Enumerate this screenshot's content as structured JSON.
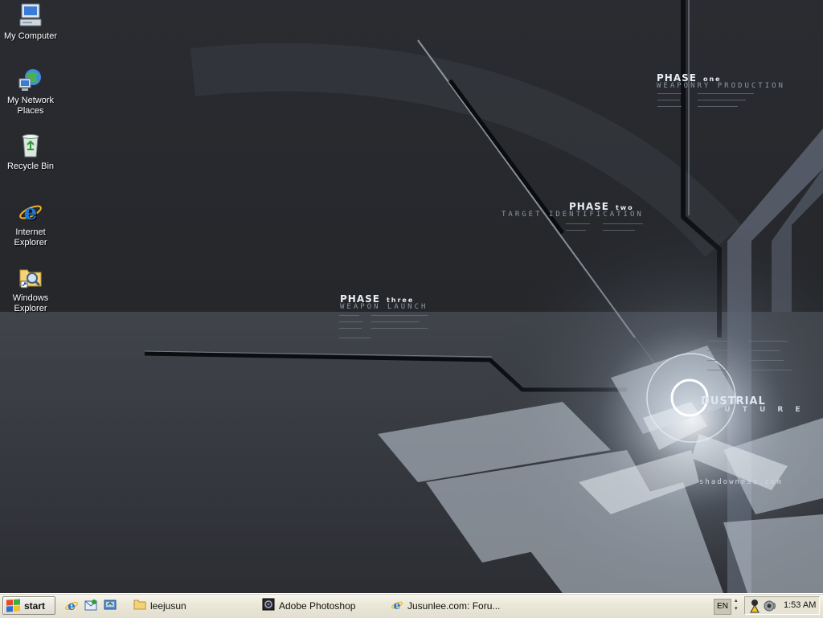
{
  "desktop": {
    "icons": [
      {
        "label": "My Computer",
        "icon": "my-computer-icon"
      },
      {
        "label": "My Network Places",
        "icon": "network-places-icon"
      },
      {
        "label": "Recycle Bin",
        "icon": "recycle-bin-icon"
      },
      {
        "label": "Internet Explorer",
        "icon": "internet-explorer-icon"
      },
      {
        "label": "Windows Explorer",
        "icon": "windows-explorer-icon"
      }
    ]
  },
  "wallpaper": {
    "phase_one": {
      "title": "PHASE",
      "number": "one",
      "subtitle": "WEAPONRY PRODUCTION"
    },
    "phase_two": {
      "title": "PHASE",
      "number": "two",
      "subtitle": "TARGET IDENTIFICATION"
    },
    "phase_three": {
      "title": "PHASE",
      "number": "three",
      "subtitle": "WEAPON LAUNCH"
    },
    "brand": "DUSTRIAL",
    "brand_sub": "F U T U R E",
    "site": "shadowness.com"
  },
  "taskbar": {
    "start_label": "start",
    "quick_launch": [
      "internet-explorer-icon",
      "outlook-express-icon",
      "show-desktop-icon"
    ],
    "buttons": [
      {
        "label": "leejusun",
        "icon": "folder-icon"
      },
      {
        "label": "Adobe Photoshop",
        "icon": "photoshop-icon"
      },
      {
        "label": "Jusunlee.com: Foru...",
        "icon": "internet-explorer-icon"
      }
    ],
    "language": "EN",
    "clock": "1:53 AM"
  },
  "colors": {
    "taskbar_bg": "#ece9d8",
    "wallpaper_bg": "#25272b",
    "icon_text": "#ffffff"
  }
}
